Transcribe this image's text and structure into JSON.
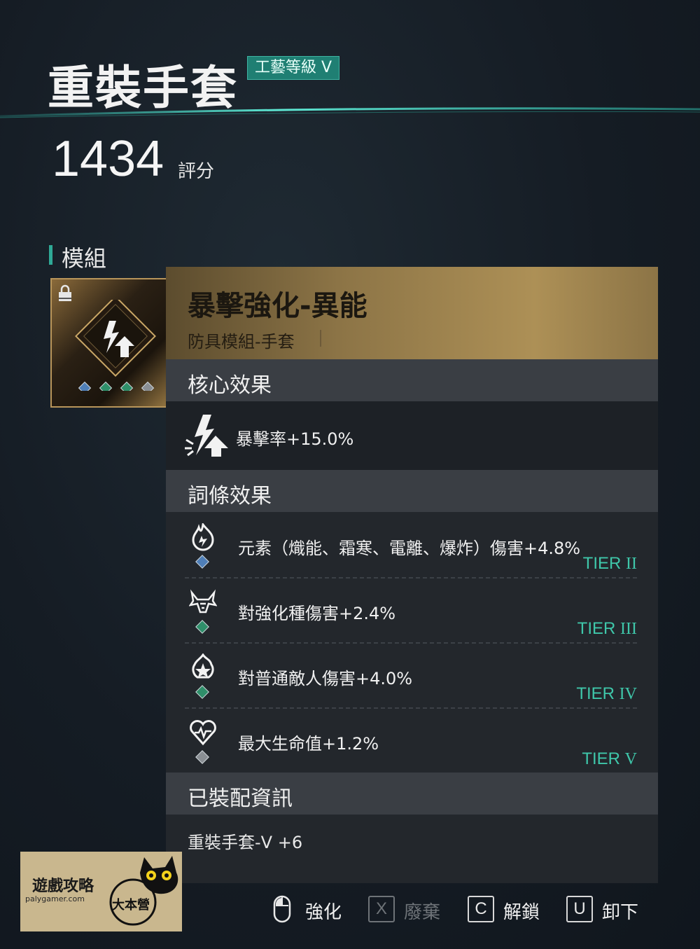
{
  "header": {
    "item_title": "重裝手套",
    "craft_badge": "工藝等級 V",
    "score_value": "1434",
    "score_unit": "評分"
  },
  "module_section": {
    "label": "模組",
    "gems": [
      "blue",
      "green",
      "green",
      "gray"
    ]
  },
  "module": {
    "name": "暴擊強化-異能",
    "type": "防具模組-手套",
    "core_section_title": "核心效果",
    "core_effect": "暴擊率+15.0%",
    "affix_section_title": "詞條效果",
    "affixes": [
      {
        "text": "元素（熾能、霜寒、電離、爆炸）傷害+4.8%",
        "tier_word": "TIER",
        "tier_roman": "II",
        "gem": "blue",
        "icon": "elemental-flame-icon"
      },
      {
        "text": "對強化種傷害+2.4%",
        "tier_word": "TIER",
        "tier_roman": "III",
        "gem": "green",
        "icon": "horned-beast-icon"
      },
      {
        "text": "對普通敵人傷害+4.0%",
        "tier_word": "TIER",
        "tier_roman": "IV",
        "gem": "green",
        "icon": "flame-burst-icon"
      },
      {
        "text": "最大生命值+1.2%",
        "tier_word": "TIER",
        "tier_roman": "V",
        "gem": "gray",
        "icon": "heartbeat-icon"
      }
    ],
    "equip_section_title": "已裝配資訊",
    "equipped_item": "重裝手套-V +6"
  },
  "actions": {
    "enhance_label": "強化",
    "discard_key": "X",
    "discard_label": "廢棄",
    "unlock_key": "C",
    "unlock_label": "解鎖",
    "unequip_key": "U",
    "unequip_label": "卸下"
  },
  "watermark": {
    "title": "遊戲攻略",
    "url": "palygamer.com",
    "badge": "大本營"
  },
  "colors": {
    "accent_teal": "#3fc7aa",
    "panel_gold": "#ad9056",
    "gem_blue": "#4f7fb8",
    "gem_green": "#2f8f6a",
    "gem_gray": "#8a8f94"
  }
}
